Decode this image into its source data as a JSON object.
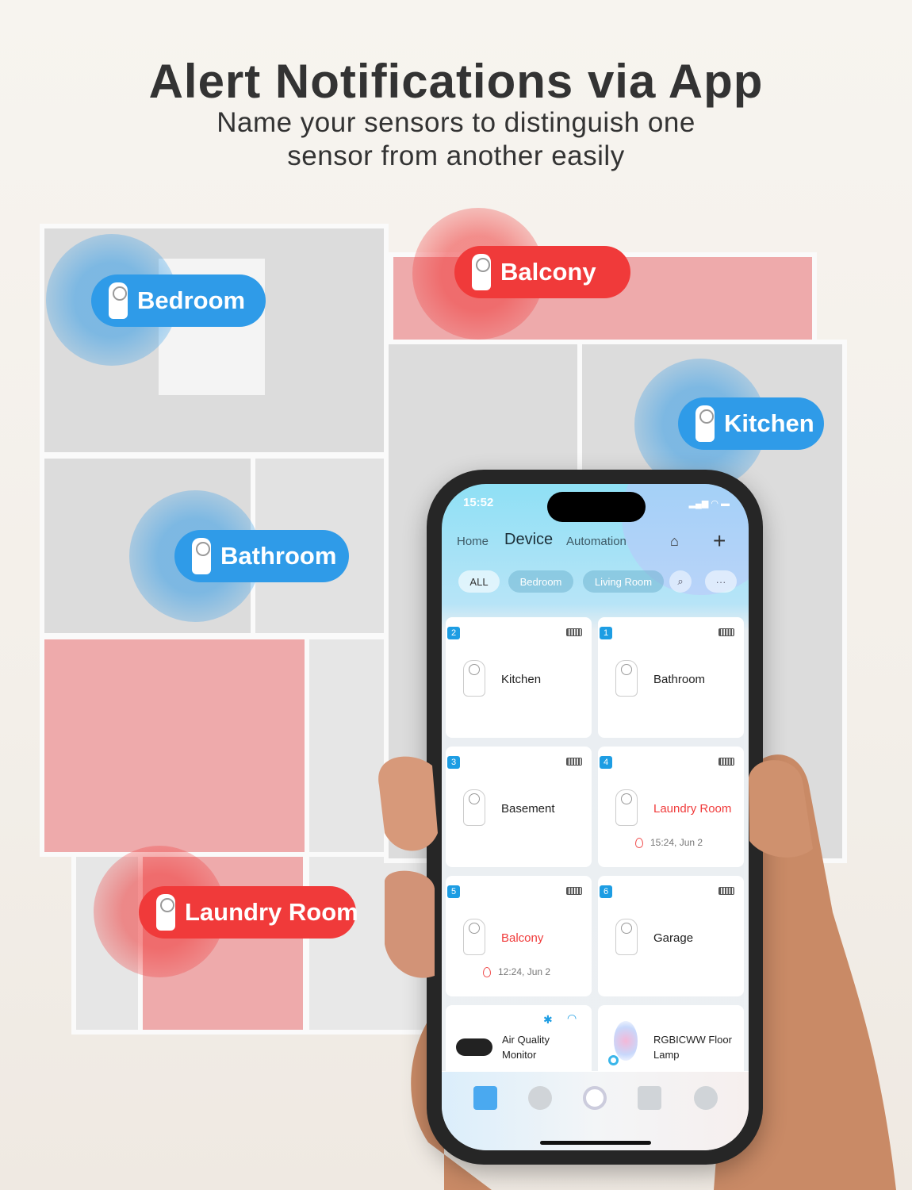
{
  "headline": "Alert Notifications via App",
  "subtitle_line1": "Name your sensors to distinguish one",
  "subtitle_line2": "sensor from another easily",
  "labels": [
    {
      "text": "Bedroom",
      "color": "#2f9be8"
    },
    {
      "text": "Balcony",
      "color": "#f03a3a"
    },
    {
      "text": "Kitchen",
      "color": "#2f9be8"
    },
    {
      "text": "Bathroom",
      "color": "#2f9be8"
    },
    {
      "text": "Laundry Room",
      "color": "#f03a3a"
    }
  ],
  "app": {
    "status_time": "15:52",
    "nav": [
      "Home",
      "Device",
      "Automation"
    ],
    "active_nav": "Device",
    "chips": [
      "ALL",
      "Bedroom",
      "Living Room"
    ],
    "more_label": "···",
    "add_label": "+",
    "devices": [
      {
        "num": "2",
        "name": "Kitchen",
        "alert": false
      },
      {
        "num": "1",
        "name": "Bathroom",
        "alert": false
      },
      {
        "num": "3",
        "name": "Basement",
        "alert": false
      },
      {
        "num": "4",
        "name": "Laundry Room",
        "alert": true,
        "time": "15:24,  Jun 2"
      },
      {
        "num": "5",
        "name": "Balcony",
        "alert": true,
        "time": "12:24,  Jun 2"
      },
      {
        "num": "6",
        "name": "Garage",
        "alert": false
      },
      {
        "name": "Air Quality Monitor"
      },
      {
        "name": "RGBICWW Floor Lamp"
      }
    ],
    "tabs": [
      "home-icon",
      "planet-icon",
      "compass-icon",
      "basket-icon",
      "users-icon"
    ],
    "accent": "#1d9de3",
    "alert_color": "#f03a3a"
  }
}
